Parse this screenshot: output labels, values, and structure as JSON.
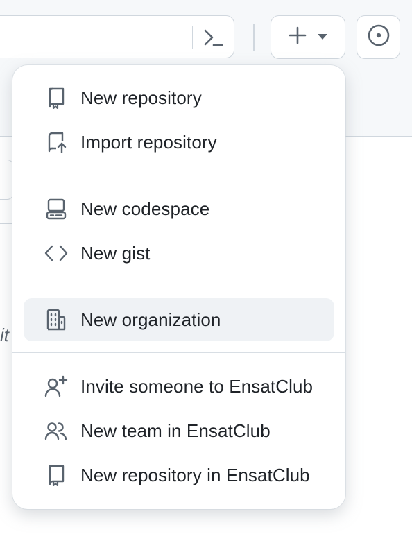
{
  "header": {
    "search_icon": "command-palette-icon",
    "create_icon": "plus-icon",
    "create_caret": "triangle-down-icon",
    "issues_icon": "issue-opened-icon"
  },
  "background": {
    "italic_fragment": "it"
  },
  "menu": {
    "groups": [
      {
        "items": [
          {
            "label": "New repository",
            "icon": "repo-icon"
          },
          {
            "label": "Import repository",
            "icon": "repo-push-icon"
          }
        ]
      },
      {
        "items": [
          {
            "label": "New codespace",
            "icon": "codespaces-icon"
          },
          {
            "label": "New gist",
            "icon": "code-icon"
          }
        ]
      },
      {
        "items": [
          {
            "label": "New organization",
            "icon": "organization-icon",
            "highlighted": true
          }
        ]
      },
      {
        "items": [
          {
            "label": "Invite someone to EnsatClub",
            "icon": "person-add-icon"
          },
          {
            "label": "New team in EnsatClub",
            "icon": "people-icon"
          },
          {
            "label": "New repository in EnsatClub",
            "icon": "repo-icon"
          }
        ]
      }
    ]
  },
  "colors": {
    "text": "#1f2328",
    "icon": "#59636e",
    "border": "#d0d7de",
    "hover_bg": "#eff2f5"
  }
}
